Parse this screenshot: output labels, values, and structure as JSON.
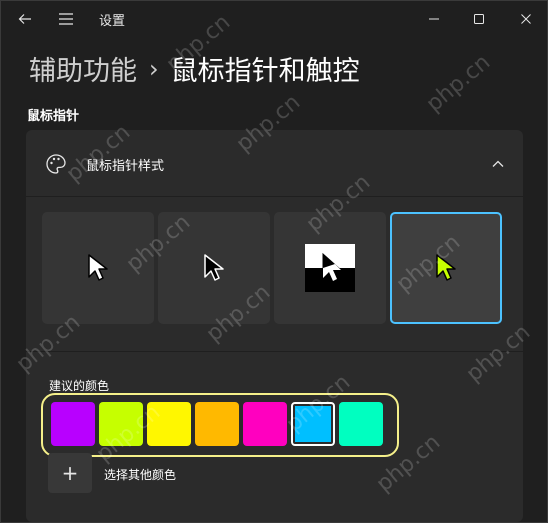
{
  "window": {
    "app_title": "设置",
    "icons": {
      "back": "back-arrow-icon",
      "menu": "hamburger-menu-icon",
      "minimize": "minimize-icon",
      "maximize": "maximize-icon",
      "close": "close-icon"
    }
  },
  "header": {
    "breadcrumb_parent": "辅助功能",
    "breadcrumb_separator": "›",
    "breadcrumb_current": "鼠标指针和触控"
  },
  "section": {
    "title": "鼠标指针"
  },
  "pointer_style_card": {
    "title": "鼠标指针样式",
    "icon": "palette-icon",
    "expanded": true,
    "styles": [
      {
        "name": "white",
        "cursor_fill": "#ffffff",
        "cursor_stroke": "#000000",
        "selected": false
      },
      {
        "name": "black",
        "cursor_fill": "#000000",
        "cursor_stroke": "#ffffff",
        "selected": false
      },
      {
        "name": "inverted",
        "selected": false
      },
      {
        "name": "custom",
        "cursor_fill": "#c6ff00",
        "cursor_stroke": "#000000",
        "selected": true
      }
    ],
    "suggested_colors_label": "建议的颜色",
    "suggested_colors": [
      "#b800ff",
      "#c6ff00",
      "#fff700",
      "#ffb900",
      "#ff00bf",
      "#00bfff",
      "#00ffc0"
    ],
    "selected_color_index": 5,
    "pick_color_button": "+",
    "pick_color_label": "选择其他颜色"
  },
  "colors": {
    "accent": "#4cc2ff",
    "highlight": "#f5f08a"
  }
}
